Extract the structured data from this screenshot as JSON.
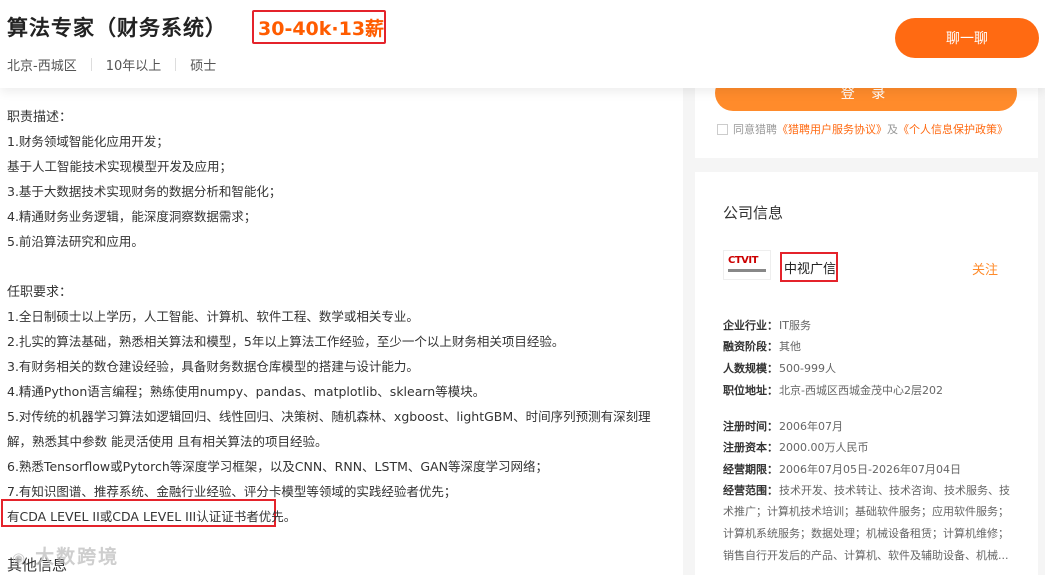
{
  "header": {
    "title": "算法专家（财务系统）",
    "salary": "30-40k·13薪",
    "location": "北京-西城区",
    "experience": "10年以上",
    "education": "硕士",
    "chat_label": "聊一聊"
  },
  "description": {
    "duties_title": "职责描述：",
    "duties": [
      "1.财务领域智能化应用开发；",
      "基于人工智能技术实现模型开发及应用；",
      "3.基于大数据技术实现财务的数据分析和智能化；",
      "4.精通财务业务逻辑，能深度洞察数据需求；",
      "5.前沿算法研究和应用。"
    ],
    "requirements_title": "任职要求：",
    "requirements": [
      "1.全日制硕士以上学历，人工智能、计算机、软件工程、数学或相关专业。",
      "2.扎实的算法基础，熟悉相关算法和模型，5年以上算法工作经验，至少一个以上财务相关项目经验。",
      "3.有财务相关的数仓建设经验，具备财务数据仓库模型的搭建与设计能力。",
      "4.精通Python语言编程；熟练使用numpy、pandas、matplotlib、sklearn等模块。",
      "5.对传统的机器学习算法如逻辑回归、线性回归、决策树、随机森林、xgboost、lightGBM、时间序列预测有深刻理",
      "解，熟悉其中参数 能灵活使用 且有相关算法的项目经验。",
      "6.熟悉Tensorflow或Pytorch等深度学习框架，以及CNN、RNN、LSTM、GAN等深度学习网络；",
      "7.有知识图谱、推荐系统、金融行业经验、评分卡模型等领域的实践经验者优先；",
      "有CDA LEVEL II或CDA LEVEL III认证证书者优先。"
    ],
    "other_title": "其他信息"
  },
  "watermark": {
    "text": "大数跨境"
  },
  "login": {
    "button_label": "登 录",
    "agree_prefix": "同意猎聘",
    "agreement": "《猎聘用户服务协议》",
    "and": "及",
    "privacy": "《个人信息保护政策》"
  },
  "company": {
    "section_title": "公司信息",
    "logo_text": "CTVIT",
    "name": "中视广信",
    "follow_label": "关注",
    "info": [
      {
        "key": "企业行业：",
        "value": "IT服务"
      },
      {
        "key": "融资阶段：",
        "value": "其他"
      },
      {
        "key": "人数规模：",
        "value": "500-999人"
      },
      {
        "key": "职位地址：",
        "value": "北京-西城区西城金茂中心2层202"
      }
    ],
    "reg": [
      {
        "key": "注册时间：",
        "value": "2006年07月"
      },
      {
        "key": "注册资本：",
        "value": "2000.00万人民币"
      },
      {
        "key": "经营期限：",
        "value": "2006年07月05日-2026年07月04日"
      }
    ],
    "scope_key": "经营范围：",
    "scope_lines": [
      "技术开发、技术转让、技术咨询、技术服务、技",
      "术推广；计算机技术培训；基础软件服务；应用软件服务；",
      "计算机系统服务；数据处理；机械设备租赁；计算机维修；",
      "销售自行开发后的产品、计算机、软件及辅助设备、机械..."
    ]
  },
  "colors": {
    "accent": "#ff6a12",
    "highlight": "#e4232b"
  }
}
